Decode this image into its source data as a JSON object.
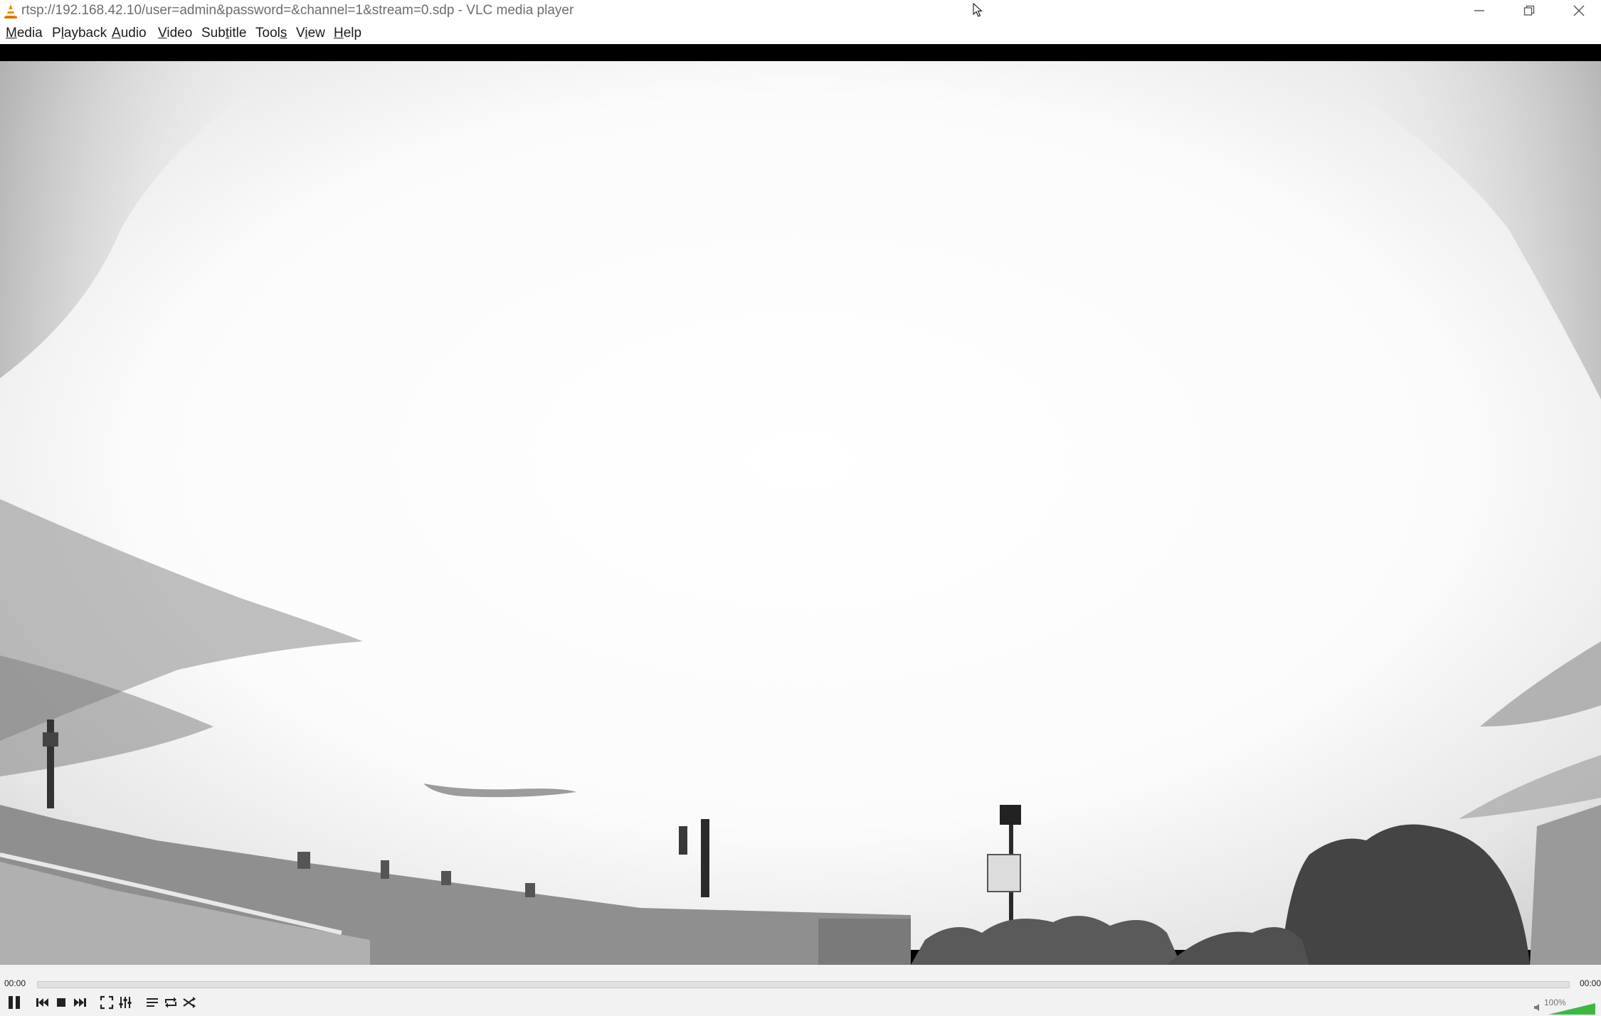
{
  "window": {
    "title": "rtsp://192.168.42.10/user=admin&password=&channel=1&stream=0.sdp - VLC media player",
    "app_icon": "vlc-cone-icon",
    "controls": [
      "minimize-icon",
      "restore-icon",
      "close-icon"
    ]
  },
  "menubar": {
    "items": [
      {
        "label": "Media",
        "accel": "M"
      },
      {
        "label": "Playback",
        "accel": "l"
      },
      {
        "label": "Audio",
        "accel": "A"
      },
      {
        "label": "Video",
        "accel": "V"
      },
      {
        "label": "Subtitle",
        "accel": "t"
      },
      {
        "label": "Tools",
        "accel": "s"
      },
      {
        "label": "View",
        "accel": "i"
      },
      {
        "label": "Help",
        "accel": "H"
      }
    ]
  },
  "player": {
    "elapsed": "00:00",
    "total": "00:00",
    "seek_progress": 0,
    "volume_label": "100%",
    "volume_level": 1.0,
    "buttons": [
      "pause-icon",
      "previous-icon",
      "stop-icon",
      "next-icon",
      "fullscreen-icon",
      "extended-settings-icon",
      "playlist-icon",
      "loop-icon",
      "shuffle-icon"
    ]
  },
  "colors": {
    "accent_orange": "#f28a00",
    "volume_green": "#3cb943"
  }
}
